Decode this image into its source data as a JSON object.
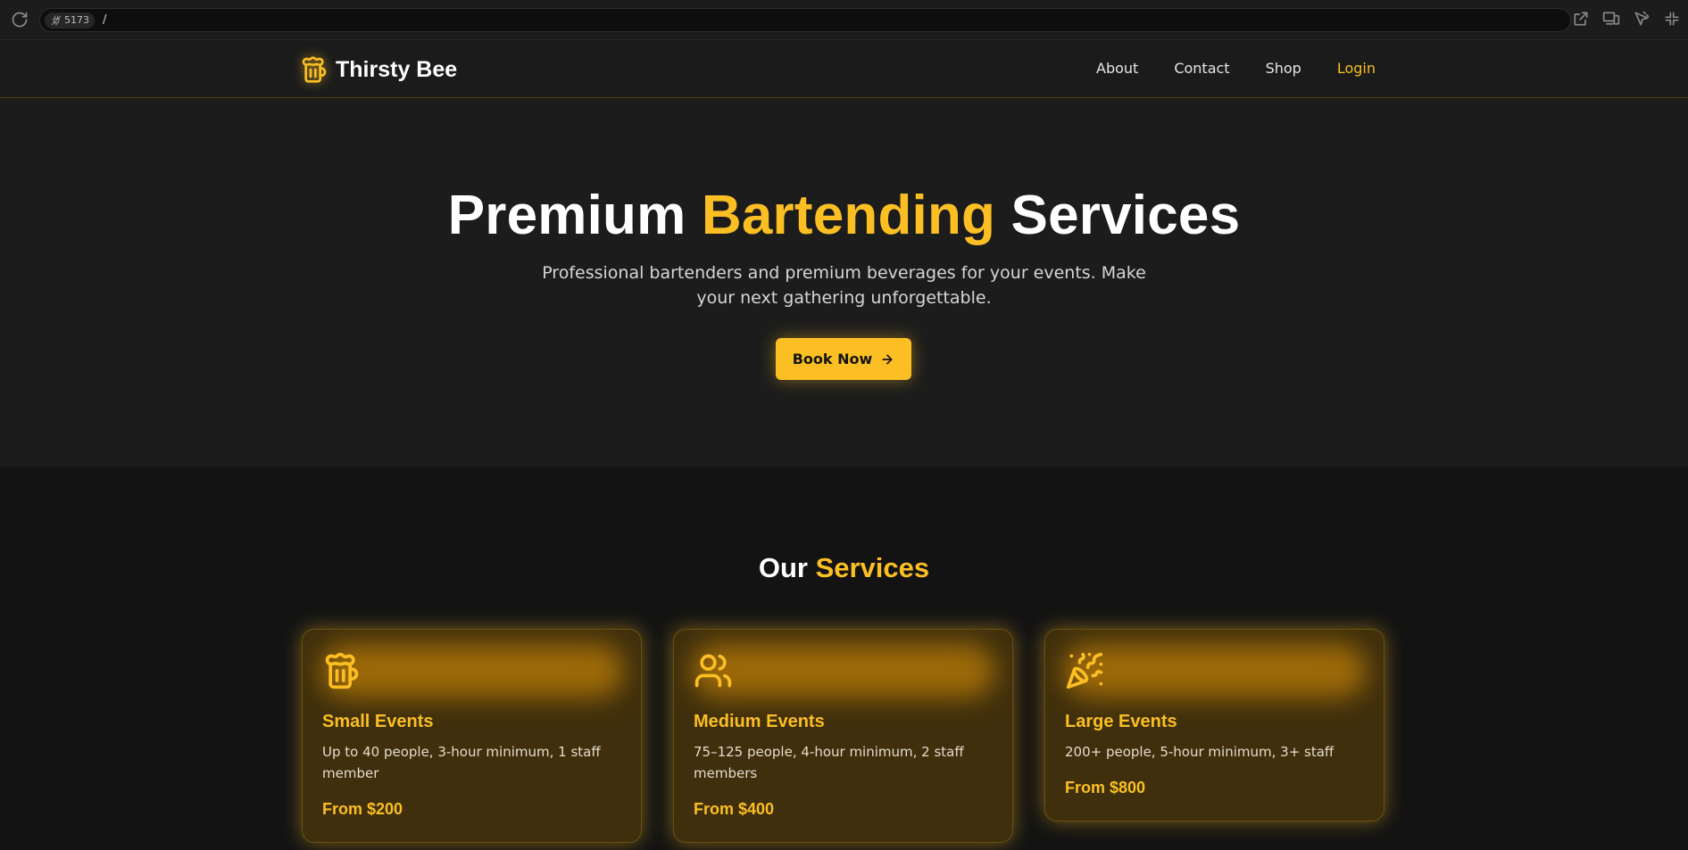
{
  "browser": {
    "port": "5173",
    "path": "/"
  },
  "nav": {
    "brand": "Thirsty Bee",
    "links": [
      {
        "label": "About"
      },
      {
        "label": "Contact"
      },
      {
        "label": "Shop"
      },
      {
        "label": "Login",
        "active": true
      }
    ]
  },
  "hero": {
    "title_part1": "Premium ",
    "title_highlight": "Bartending",
    "title_part2": " Services",
    "subtitle": "Professional bartenders and premium beverages for your events. Make your next gathering unforgettable.",
    "cta_label": "Book Now"
  },
  "services": {
    "heading_part1": "Our ",
    "heading_highlight": "Services",
    "cards": [
      {
        "icon": "beer-mug-icon",
        "title": "Small Events",
        "description": "Up to 40 people, 3-hour minimum, 1 staff member",
        "price": "From $200"
      },
      {
        "icon": "users-icon",
        "title": "Medium Events",
        "description": "75–125 people, 4-hour minimum, 2 staff members",
        "price": "From $400"
      },
      {
        "icon": "party-popper-icon",
        "title": "Large Events",
        "description": "200+ people, 5-hour minimum, 3+ staff",
        "price": "From $800"
      }
    ]
  },
  "colors": {
    "accent": "#fbbf24",
    "background": "#131313",
    "hero_background": "#1c1c1c",
    "card_background": "#3f2f0c"
  }
}
